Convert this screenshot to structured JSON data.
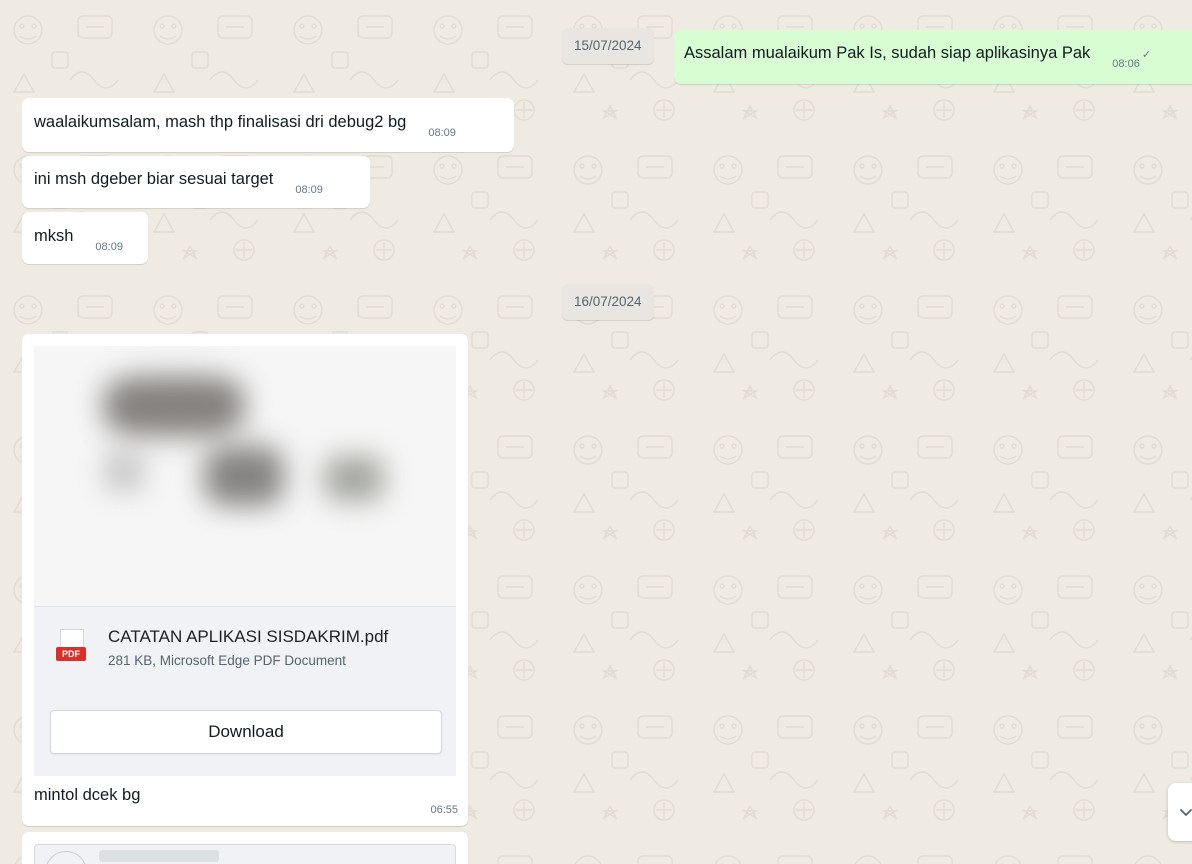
{
  "colors": {
    "chat_background": "#efeae2",
    "incoming_bubble": "#ffffff",
    "outgoing_bubble": "#d9fdd3",
    "date_pill": "#e9e6e2",
    "pdf_badge": "#d9302b"
  },
  "date_separators": [
    {
      "label": "15/07/2024"
    },
    {
      "label": "16/07/2024"
    }
  ],
  "messages": [
    {
      "direction": "out",
      "text": "Assalam mualaikum Pak Is, sudah siap aplikasinya Pak",
      "time": "08:06"
    },
    {
      "direction": "in",
      "text": "waalaikumsalam, mash thp finalisasi dri debug2 bg",
      "time": "08:09"
    },
    {
      "direction": "in",
      "text": "ini msh dgeber biar sesuai target",
      "time": "08:09"
    },
    {
      "direction": "in",
      "text": "mksh",
      "time": "08:09"
    }
  ],
  "document_message": {
    "file_name": "CATATAN APLIKASI SISDAKRIM.pdf",
    "file_meta": "281 KB, Microsoft Edge PDF Document",
    "file_icon": "pdf-file-icon",
    "file_badge": "PDF",
    "download_label": "Download",
    "caption": "mintol dcek bg",
    "time": "06:55"
  },
  "scroll_button": {
    "icon": "chevron-down-icon"
  }
}
